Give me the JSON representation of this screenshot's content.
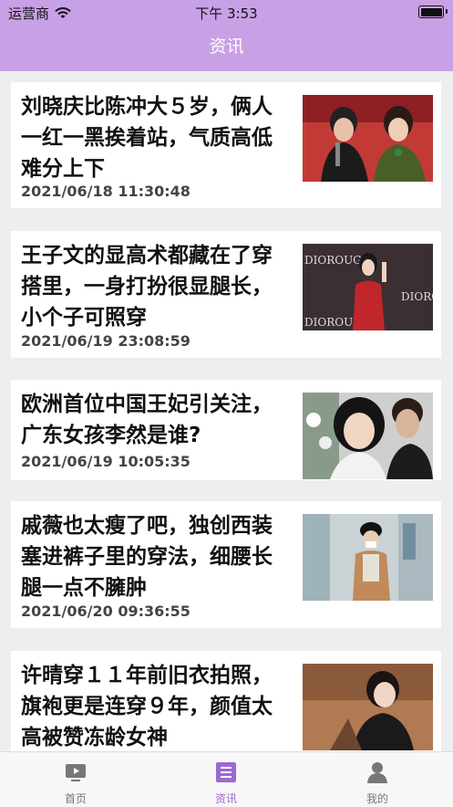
{
  "status_bar": {
    "carrier": "运营商",
    "time": "下午 3:53"
  },
  "nav": {
    "title": "资讯"
  },
  "articles": [
    {
      "title": "刘晓庆比陈冲大５岁，俩人一红一黑挨着站，气质高低难分上下",
      "date": "2021/06/18 11:30:48"
    },
    {
      "title": "王子文的显高术都藏在了穿搭里，一身打扮很显腿长，小个子可照穿",
      "date": "2021/06/19 23:08:59"
    },
    {
      "title": "欧洲首位中国王妃引关注，广东女孩李然是谁?",
      "date": "2021/06/19 10:05:35"
    },
    {
      "title": "戚薇也太瘦了吧，独创西装塞进裤子里的穿法，细腰长腿一点不臃肿",
      "date": "2021/06/20 09:36:55"
    },
    {
      "title": "许晴穿１１年前旧衣拍照，旗袍更是连穿９年，颜值太高被赞冻龄女神",
      "date": ""
    }
  ],
  "thumb_text": {
    "dior": "DIOROUGE"
  },
  "tabs": [
    {
      "label": "首页",
      "icon": "video-play-icon"
    },
    {
      "label": "资讯",
      "icon": "news-list-icon"
    },
    {
      "label": "我的",
      "icon": "person-icon"
    }
  ],
  "colors": {
    "brand": "#c8a0e6",
    "active_tab": "#9b6ad0"
  }
}
